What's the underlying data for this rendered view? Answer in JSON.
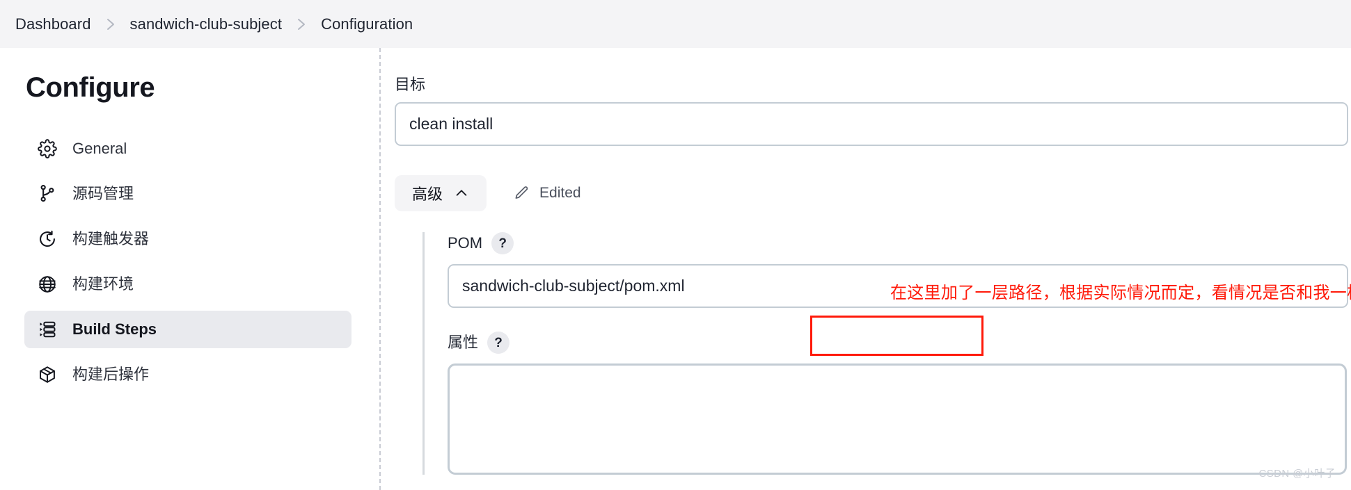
{
  "breadcrumb": {
    "items": [
      {
        "label": "Dashboard"
      },
      {
        "label": "sandwich-club-subject"
      },
      {
        "label": "Configuration"
      }
    ],
    "separator_icon": "chevron-right-icon"
  },
  "sidebar": {
    "title": "Configure",
    "items": [
      {
        "label": "General",
        "icon": "gear-icon",
        "selected": false
      },
      {
        "label": "源码管理",
        "icon": "git-branch-icon",
        "selected": false
      },
      {
        "label": "构建触发器",
        "icon": "clock-icon",
        "selected": false
      },
      {
        "label": "构建环境",
        "icon": "globe-icon",
        "selected": false
      },
      {
        "label": "Build Steps",
        "icon": "build-steps-icon",
        "selected": true
      },
      {
        "label": "构建后操作",
        "icon": "package-icon",
        "selected": false
      }
    ]
  },
  "main": {
    "goals": {
      "label": "目标",
      "value": "clean install",
      "placeholder": ""
    },
    "advanced": {
      "button_label": "高级",
      "button_icon": "chevron-up-icon",
      "edited_label": "Edited",
      "edited_icon": "pencil-icon"
    },
    "pom": {
      "label": "POM",
      "help_icon": "?",
      "value": "sandwich-club-subject/pom.xml",
      "placeholder": ""
    },
    "properties": {
      "label": "属性",
      "help_icon": "?",
      "value": "",
      "placeholder": ""
    }
  },
  "annotations": {
    "red_note": "在这里加了一层路径，根据实际情况而定，看情况是否和我一样，正常情况不需要修改这里",
    "red_color": "#ff1a0a",
    "highlight_box_name": "pom-field-highlight"
  },
  "watermark": {
    "text": "CSDN @小叶子"
  },
  "colors": {
    "header_bg": "#f4f4f6",
    "selected_nav_bg": "#e9eaee",
    "input_border": "#c3ccd4",
    "divider": "#c9ccd4",
    "text": "#1f2430"
  }
}
